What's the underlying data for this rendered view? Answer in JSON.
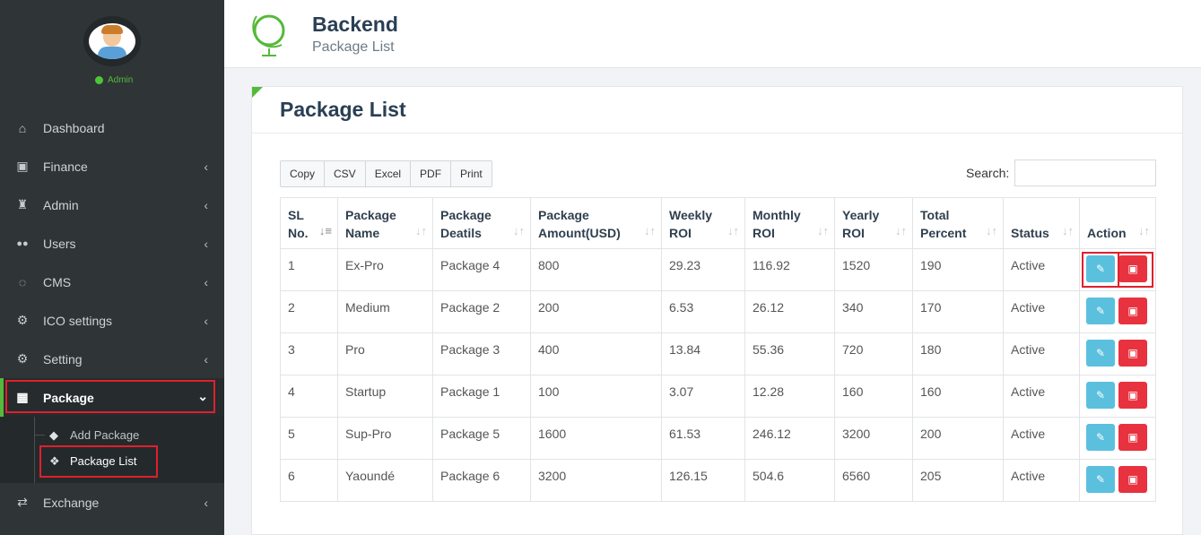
{
  "sidebar": {
    "user_status": "Admin",
    "items": [
      {
        "label": "Dashboard",
        "icon": "home-icon",
        "glyph": "⌂"
      },
      {
        "label": "Finance",
        "icon": "money-icon",
        "glyph": "▣"
      },
      {
        "label": "Admin",
        "icon": "user-lock-icon",
        "glyph": "♜"
      },
      {
        "label": "Users",
        "icon": "users-icon",
        "glyph": "👥"
      },
      {
        "label": "CMS",
        "icon": "comments-icon",
        "glyph": "✎"
      },
      {
        "label": "ICO settings",
        "icon": "settings-icon",
        "glyph": "⚙"
      },
      {
        "label": "Setting",
        "icon": "gear-icon",
        "glyph": "⚙"
      },
      {
        "label": "Package",
        "icon": "gift-icon",
        "glyph": "🎁"
      },
      {
        "label": "Exchange",
        "icon": "exchange-icon",
        "glyph": "⇄"
      }
    ],
    "submenu": [
      {
        "label": "Add Package",
        "icon": "cube-icon",
        "glyph": "◆"
      },
      {
        "label": "Package List",
        "icon": "cubes-icon",
        "glyph": "❖"
      }
    ]
  },
  "header": {
    "title": "Backend",
    "subtitle": "Package List"
  },
  "card": {
    "title": "Package List",
    "buttons": [
      "Copy",
      "CSV",
      "Excel",
      "PDF",
      "Print"
    ],
    "search_label": "Search:",
    "search_value": ""
  },
  "table": {
    "columns": [
      {
        "line1": "SL",
        "line2": "No."
      },
      {
        "line1": "Package",
        "line2": "Name"
      },
      {
        "line1": "Package",
        "line2": "Deatils"
      },
      {
        "line1": "Package",
        "line2": "Amount(USD)"
      },
      {
        "line1": "Weekly",
        "line2": "ROI"
      },
      {
        "line1": "Monthly",
        "line2": "ROI"
      },
      {
        "line1": "Yearly",
        "line2": "ROI"
      },
      {
        "line1": "Total",
        "line2": "Percent"
      },
      {
        "line1": "",
        "line2": "Status"
      },
      {
        "line1": "",
        "line2": "Action"
      }
    ],
    "rows": [
      [
        "1",
        "Ex-Pro",
        "Package 4",
        "800",
        "29.23",
        "116.92",
        "1520",
        "190",
        "Active"
      ],
      [
        "2",
        "Medium",
        "Package 2",
        "200",
        "6.53",
        "26.12",
        "340",
        "170",
        "Active"
      ],
      [
        "3",
        "Pro",
        "Package 3",
        "400",
        "13.84",
        "55.36",
        "720",
        "180",
        "Active"
      ],
      [
        "4",
        "Startup",
        "Package 1",
        "100",
        "3.07",
        "12.28",
        "160",
        "160",
        "Active"
      ],
      [
        "5",
        "Sup-Pro",
        "Package 5",
        "1600",
        "61.53",
        "246.12",
        "3200",
        "200",
        "Active"
      ],
      [
        "6",
        "Yaoundé",
        "Package 6",
        "3200",
        "126.15",
        "504.6",
        "6560",
        "205",
        "Active"
      ]
    ]
  },
  "colors": {
    "accent": "#55b93b",
    "sidebar_bg": "#2f3437",
    "edit_button": "#5bc0de",
    "delete_button": "#e8323f",
    "highlight": "#e0202c"
  }
}
